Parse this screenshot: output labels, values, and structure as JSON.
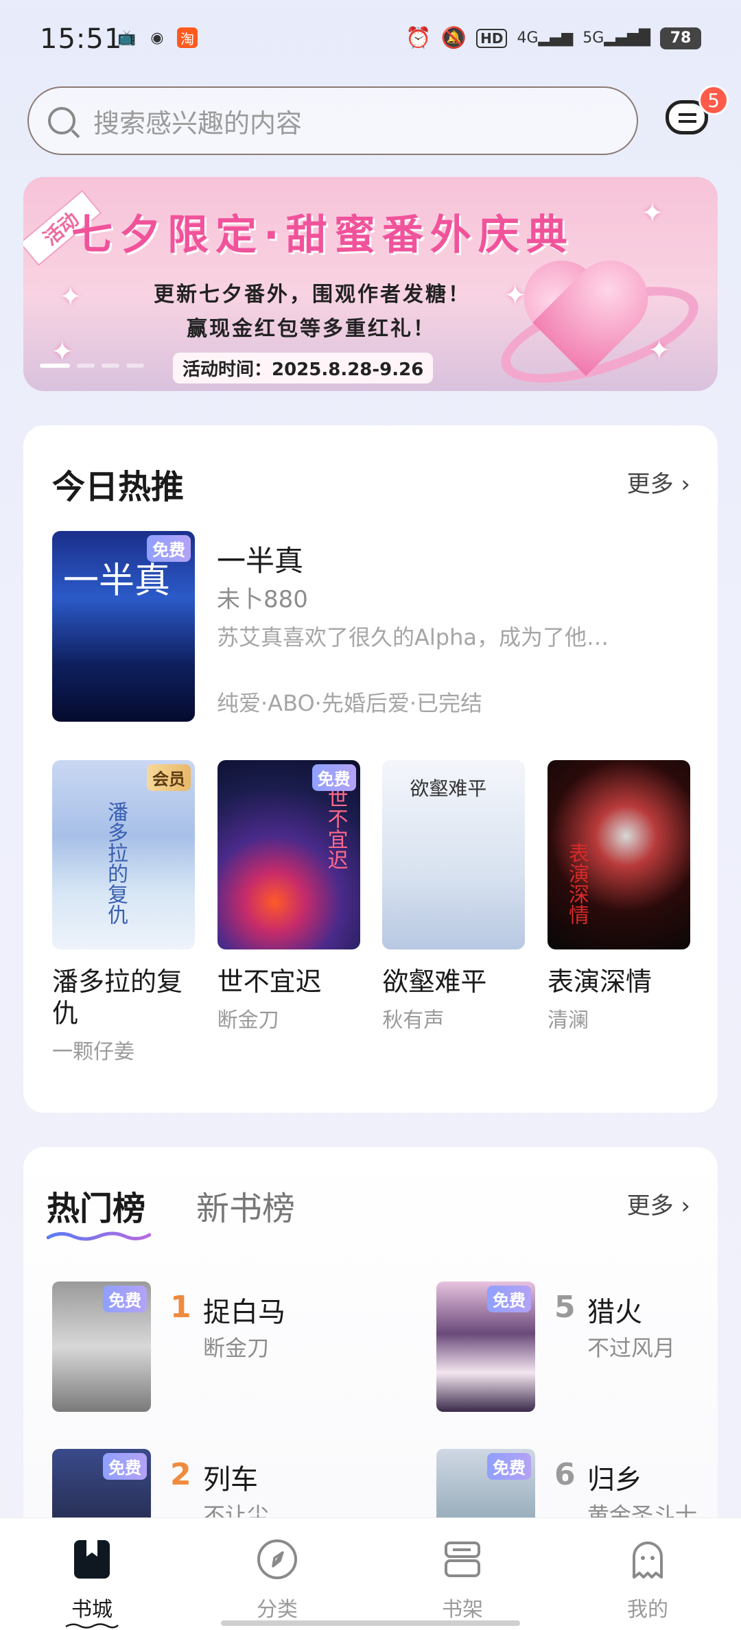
{
  "status_bar": {
    "time": "15:51",
    "battery": "78",
    "network_labels": [
      "HD",
      "4G",
      "5G"
    ]
  },
  "search": {
    "placeholder": "搜索感兴趣的内容",
    "message_badge": "5"
  },
  "banner": {
    "ribbon": "活动",
    "title": "七夕限定·甜蜜番外庆典",
    "line1": "更新七夕番外，围观作者发糖！",
    "line2": "赢现金红包等多重红礼！",
    "date": "活动时间：2025.8.28-9.26",
    "page_count": 4,
    "active_page": 1
  },
  "today": {
    "heading": "今日热推",
    "more": "更多",
    "featured": {
      "title": "一半真",
      "author": "未卜880",
      "desc": "苏艾真喜欢了很久的Alpha，成为了他…",
      "tags": "纯爱·ABO·先婚后爱·已完结",
      "badge": "免费",
      "cover_text": "一半真"
    },
    "books": [
      {
        "title": "潘多拉的复仇",
        "author": "一颗仔姜",
        "badge": "会员",
        "cover_text": "潘多拉的复仇"
      },
      {
        "title": "世不宜迟",
        "author": "断金刀",
        "badge": "免费",
        "cover_text": "世不宜迟"
      },
      {
        "title": "欲壑难平",
        "author": "秋有声",
        "badge": "",
        "cover_text": "欲壑难平"
      },
      {
        "title": "表演深情",
        "author": "清澜",
        "badge": "",
        "cover_text": "表演深情"
      }
    ]
  },
  "rankings": {
    "tabs": [
      "热门榜",
      "新书榜"
    ],
    "more": "更多",
    "items": [
      {
        "rank": "1",
        "title": "捉白马",
        "author": "断金刀",
        "badge": "免费"
      },
      {
        "rank": "5",
        "title": "猎火",
        "author": "不过风月",
        "badge": "免费"
      },
      {
        "rank": "2",
        "title": "列车",
        "author": "不让尘",
        "badge": "免费"
      },
      {
        "rank": "6",
        "title": "归乡",
        "author": "黄金圣斗士",
        "badge": "免费"
      }
    ]
  },
  "nav": {
    "items": [
      {
        "label": "书城",
        "icon": "book-icon",
        "active": true
      },
      {
        "label": "分类",
        "icon": "compass-icon",
        "active": false
      },
      {
        "label": "书架",
        "icon": "bookshelf-icon",
        "active": false
      },
      {
        "label": "我的",
        "icon": "ghost-icon",
        "active": false
      }
    ]
  },
  "colors": {
    "accent_pink": "#f1539b",
    "rank_orange": "#f08a3c",
    "badge_red": "#ff5b4a"
  }
}
